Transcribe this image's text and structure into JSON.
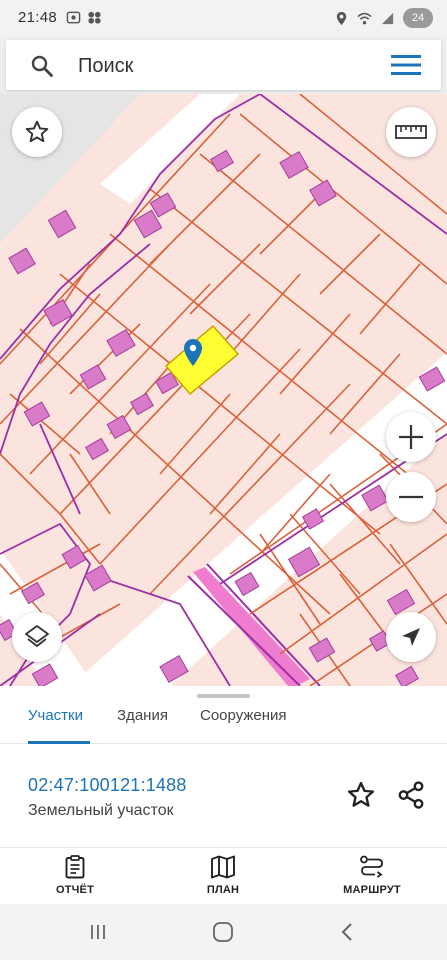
{
  "status_bar": {
    "time": "21:48",
    "battery": "24"
  },
  "search": {
    "placeholder": "Поиск"
  },
  "map": {
    "selected_parcel_color": "#ffff33",
    "marker_color": "#1b74b8",
    "controls": {
      "favorite": "star-icon",
      "ruler": "ruler-icon",
      "zoom_in": "plus-icon",
      "zoom_out": "minus-icon",
      "layers": "layers-icon",
      "locate": "navigation-arrow-icon"
    }
  },
  "sheet": {
    "tabs": [
      {
        "label": "Участки",
        "active": true
      },
      {
        "label": "Здания",
        "active": false
      },
      {
        "label": "Сооружения",
        "active": false
      }
    ],
    "parcel": {
      "cadastral_number": "02:47:100121:1488",
      "type": "Земельный участок"
    }
  },
  "bottom_nav": {
    "report": "ОТЧЁТ",
    "plan": "ПЛАН",
    "route": "МАРШРУТ"
  },
  "colors": {
    "accent": "#1b74b8",
    "parcel_fill": "#fbe4dd",
    "parcel_border": "#d9623b",
    "building": "#d97bc9",
    "boundary": "#9b2fa6"
  }
}
